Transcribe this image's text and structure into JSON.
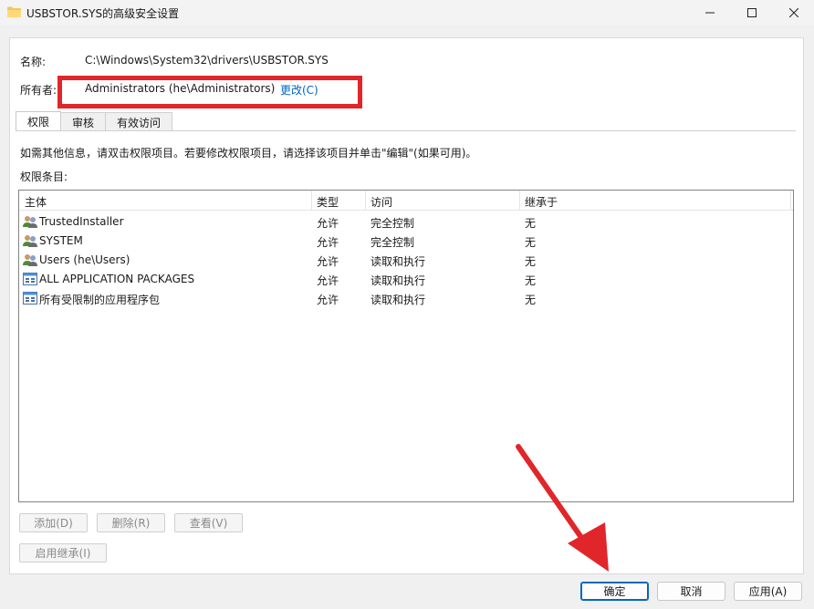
{
  "window": {
    "title": "USBSTOR.SYS的高级安全设置"
  },
  "fields": {
    "name_label": "名称:",
    "name_value": "C:\\Windows\\System32\\drivers\\USBSTOR.SYS",
    "owner_label": "所有者:",
    "owner_value": "Administrators (he\\Administrators)",
    "owner_change": "更改(C)"
  },
  "tabs": [
    {
      "label": "权限",
      "active": true
    },
    {
      "label": "审核",
      "active": false
    },
    {
      "label": "有效访问",
      "active": false
    }
  ],
  "info_text": "如需其他信息，请双击权限项目。若要修改权限项目，请选择该项目并单击\"编辑\"(如果可用)。",
  "permissions_title": "权限条目:",
  "columns": [
    "主体",
    "类型",
    "访问",
    "继承于"
  ],
  "rows": [
    {
      "principal": "TrustedInstaller",
      "icon": "user-group-icon",
      "type": "允许",
      "access": "完全控制",
      "inherited": "无"
    },
    {
      "principal": "SYSTEM",
      "icon": "user-group-icon",
      "type": "允许",
      "access": "完全控制",
      "inherited": "无"
    },
    {
      "principal": "Users (he\\Users)",
      "icon": "user-group-icon",
      "type": "允许",
      "access": "读取和执行",
      "inherited": "无"
    },
    {
      "principal": "ALL APPLICATION PACKAGES",
      "icon": "app-package-icon",
      "type": "允许",
      "access": "读取和执行",
      "inherited": "无"
    },
    {
      "principal": "所有受限制的应用程序包",
      "icon": "app-package-icon",
      "type": "允许",
      "access": "读取和执行",
      "inherited": "无"
    }
  ],
  "buttons": {
    "add": "添加(D)",
    "remove": "删除(R)",
    "view": "查看(V)",
    "enable_inheritance": "启用继承(I)",
    "ok": "确定",
    "cancel": "取消",
    "apply": "应用(A)"
  },
  "colors": {
    "highlight": "#e1262b",
    "link": "#0067c0",
    "arrow": "#e1262b"
  }
}
